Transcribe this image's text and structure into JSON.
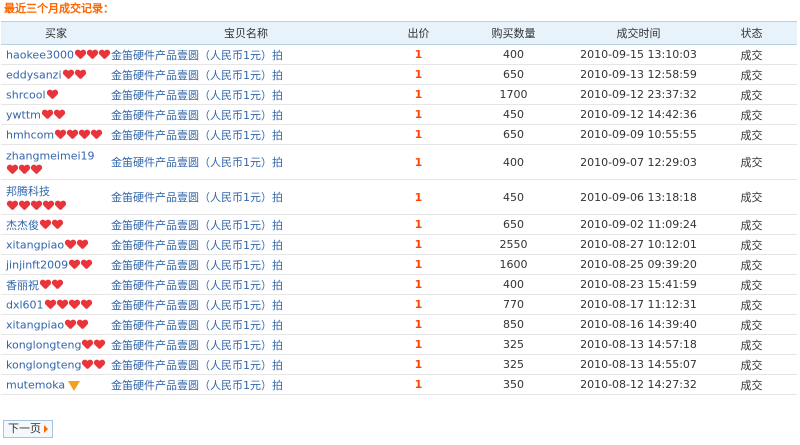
{
  "section": {
    "title": "最近三个月成交记录："
  },
  "table": {
    "headers": {
      "buyer": "买家",
      "item": "宝贝名称",
      "price": "出价",
      "qty": "购买数量",
      "time": "成交时间",
      "status": "状态"
    },
    "rows": [
      {
        "buyer": "haokee3000",
        "badge": "heart",
        "badge_count": 3,
        "item": "金笛硬件产品壹圆（人民币1元）拍",
        "price": "1",
        "qty": "400",
        "time": "2010-09-15 13:10:03",
        "status": "成交"
      },
      {
        "buyer": "eddysanzi",
        "badge": "heart",
        "badge_count": 2,
        "item": "金笛硬件产品壹圆（人民币1元）拍",
        "price": "1",
        "qty": "650",
        "time": "2010-09-13 12:58:59",
        "status": "成交"
      },
      {
        "buyer": "shrcool",
        "badge": "heart",
        "badge_count": 1,
        "item": "金笛硬件产品壹圆（人民币1元）拍",
        "price": "1",
        "qty": "1700",
        "time": "2010-09-12 23:37:32",
        "status": "成交"
      },
      {
        "buyer": "ywttm",
        "badge": "heart",
        "badge_count": 2,
        "item": "金笛硬件产品壹圆（人民币1元）拍",
        "price": "1",
        "qty": "450",
        "time": "2010-09-12 14:42:36",
        "status": "成交"
      },
      {
        "buyer": "hmhcom",
        "badge": "heart",
        "badge_count": 4,
        "item": "金笛硬件产品壹圆（人民币1元）拍",
        "price": "1",
        "qty": "650",
        "time": "2010-09-09 10:55:55",
        "status": "成交"
      },
      {
        "buyer": "zhangmeimei19",
        "badge": "heart",
        "badge_count": 3,
        "tall": true,
        "item": "金笛硬件产品壹圆（人民币1元）拍",
        "price": "1",
        "qty": "400",
        "time": "2010-09-07 12:29:03",
        "status": "成交"
      },
      {
        "buyer": "邦腾科技",
        "badge": "heart",
        "badge_count": 5,
        "tall": true,
        "item": "金笛硬件产品壹圆（人民币1元）拍",
        "price": "1",
        "qty": "450",
        "time": "2010-09-06 13:18:18",
        "status": "成交"
      },
      {
        "buyer": "杰杰俊",
        "badge": "heart",
        "badge_count": 2,
        "item": "金笛硬件产品壹圆（人民币1元）拍",
        "price": "1",
        "qty": "650",
        "time": "2010-09-02 11:09:24",
        "status": "成交"
      },
      {
        "buyer": "xitangpiao",
        "badge": "heart",
        "badge_count": 2,
        "item": "金笛硬件产品壹圆（人民币1元）拍",
        "price": "1",
        "qty": "2550",
        "time": "2010-08-27 10:12:01",
        "status": "成交"
      },
      {
        "buyer": "jinjinft2009",
        "badge": "heart",
        "badge_count": 2,
        "item": "金笛硬件产品壹圆（人民币1元）拍",
        "price": "1",
        "qty": "1600",
        "time": "2010-08-25 09:39:20",
        "status": "成交"
      },
      {
        "buyer": "香丽祝",
        "badge": "heart",
        "badge_count": 2,
        "item": "金笛硬件产品壹圆（人民币1元）拍",
        "price": "1",
        "qty": "400",
        "time": "2010-08-23 15:41:59",
        "status": "成交"
      },
      {
        "buyer": "dxl601",
        "badge": "heart",
        "badge_count": 4,
        "item": "金笛硬件产品壹圆（人民币1元）拍",
        "price": "1",
        "qty": "770",
        "time": "2010-08-17 11:12:31",
        "status": "成交"
      },
      {
        "buyer": "xitangpiao",
        "badge": "heart",
        "badge_count": 2,
        "item": "金笛硬件产品壹圆（人民币1元）拍",
        "price": "1",
        "qty": "850",
        "time": "2010-08-16 14:39:40",
        "status": "成交"
      },
      {
        "buyer": "konglongteng",
        "badge": "heart",
        "badge_count": 2,
        "item": "金笛硬件产品壹圆（人民币1元）拍",
        "price": "1",
        "qty": "325",
        "time": "2010-08-13 14:57:18",
        "status": "成交"
      },
      {
        "buyer": "konglongteng",
        "badge": "heart",
        "badge_count": 2,
        "item": "金笛硬件产品壹圆（人民币1元）拍",
        "price": "1",
        "qty": "325",
        "time": "2010-08-13 14:55:07",
        "status": "成交"
      },
      {
        "buyer": "mutemoka",
        "badge": "diamond",
        "badge_count": 1,
        "item": "金笛硬件产品壹圆（人民币1元）拍",
        "price": "1",
        "qty": "350",
        "time": "2010-08-12 14:27:32",
        "status": "成交"
      }
    ]
  },
  "pager": {
    "next_label": "下一页"
  },
  "colors": {
    "title": "#ff6600",
    "link": "#3366aa",
    "price": "#ff4400",
    "header_bg": "#e8f2fb",
    "heart": "#e8343a",
    "diamond": "#f0a21e"
  },
  "icons": {
    "heart": "heart-icon",
    "diamond": "diamond-icon",
    "next": "arrow-right-icon"
  }
}
